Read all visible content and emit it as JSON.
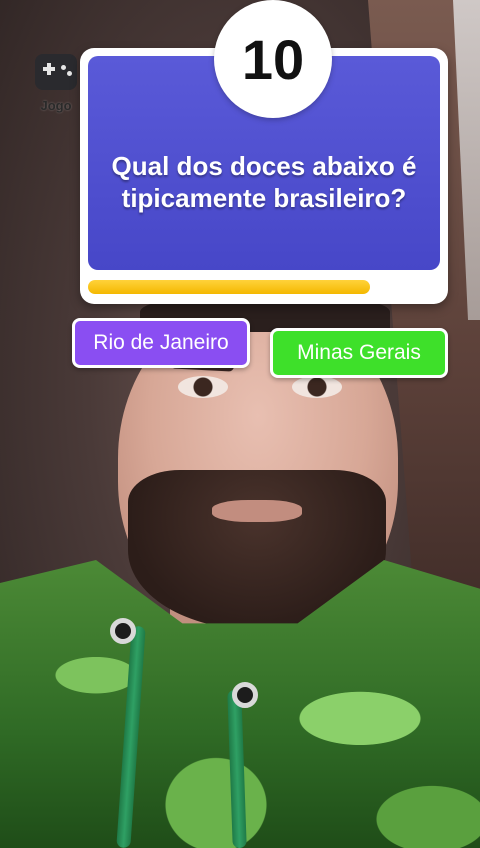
{
  "effect": {
    "icon": "gamepad-icon",
    "label": "Jogo"
  },
  "question": {
    "number": "10",
    "text": "Qual dos doces abaixo é tipicamente brasileiro?",
    "timer_remaining": 0.8
  },
  "answers": [
    {
      "label": "Rio de Janeiro",
      "color": "#8a4ef2"
    },
    {
      "label": "Minas Gerais",
      "color": "#3ee02a"
    }
  ],
  "colors": {
    "card_blue": "#4747c8",
    "timer_yellow": "#f4b800"
  }
}
